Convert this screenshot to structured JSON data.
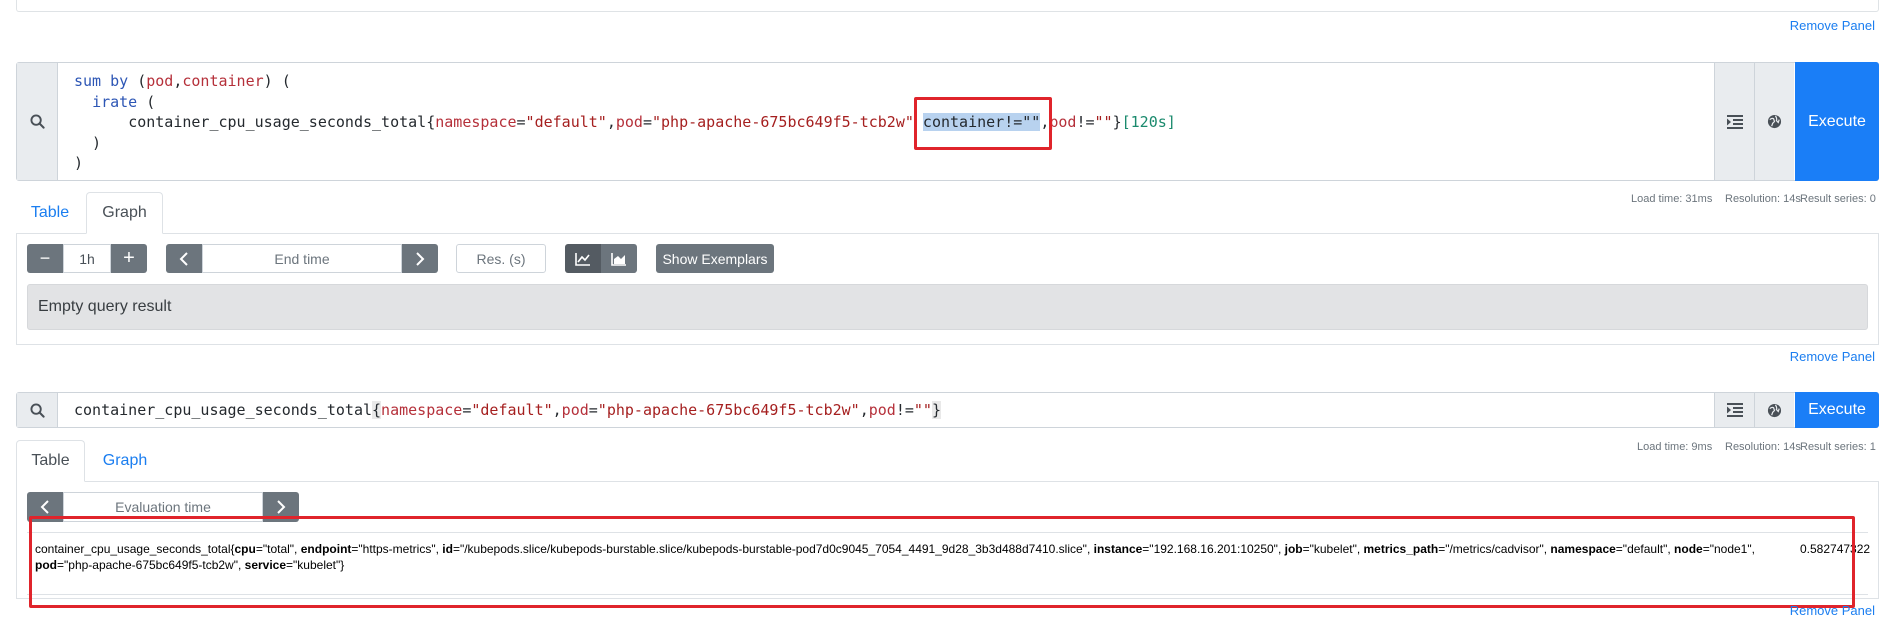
{
  "panel1": {
    "remove_label": "Remove Panel"
  },
  "panel2": {
    "query_lines": [
      [
        "sum by (pod,container) ("
      ],
      [
        "  irate ("
      ],
      [
        "      container_cpu_usage_seconds_total{namespace=\"default\",pod=\"php-apache-675bc649f5-tcb2w\" container!=\"\",pod!=\"\"}[120s]"
      ],
      [
        "  )"
      ],
      [
        ")"
      ]
    ],
    "q": {
      "l1_kw": "sum by",
      "l1_open": " (",
      "l1_pod": "pod",
      "l1_comma": ",",
      "l1_container": "container",
      "l1_close": ") (",
      "l2_kw": "irate",
      "l2_rest": " (",
      "l3_metric": "container_cpu_usage_seconds_total",
      "l3_brace_open": "{",
      "l3_ns_label": "namespace",
      "l3_eq1": "=",
      "l3_ns_val": "\"default\"",
      "l3_comma1": ",",
      "l3_pod_label": "pod",
      "l3_eq2": "=",
      "l3_pod_val": "\"php-apache-675bc649f5-tcb2w\"",
      "l3_space": " ",
      "l3_container_sel": "container!=\"\"",
      "l3_comma2": ",",
      "l3_pod2_label": "pod",
      "l3_neq": "!=",
      "l3_pod2_val": "\"\"",
      "l3_brace_close": "}",
      "l3_range": "[120s]",
      "l4": "  )",
      "l5": ")"
    },
    "execute_label": "Execute",
    "stats": {
      "load_time": "Load time: 31ms",
      "resolution": "Resolution: 14s",
      "result_series": "Result series: 0"
    },
    "tabs": {
      "table": "Table",
      "graph": "Graph"
    },
    "active_tab": "Graph",
    "graph_controls": {
      "minus": "−",
      "range": "1h",
      "plus": "+",
      "end_time_placeholder": "End time",
      "res_placeholder": "Res. (s)",
      "exemplars_label": "Show Exemplars"
    },
    "empty_result": "Empty query result",
    "remove_label": "Remove Panel"
  },
  "panel3": {
    "q": {
      "metric": "container_cpu_usage_seconds_total",
      "brace_open": "{",
      "ns_label": "namespace",
      "eq1": "=",
      "ns_val": "\"default\"",
      "comma1": ",",
      "pod_label": "pod",
      "eq2": "=",
      "pod_val": "\"php-apache-675bc649f5-tcb2w\"",
      "comma2": ",",
      "pod2_label": "pod",
      "neq": "!=",
      "pod2_val": "\"\"",
      "brace_close": "}"
    },
    "execute_label": "Execute",
    "stats": {
      "load_time": "Load time: 9ms",
      "resolution": "Resolution: 14s",
      "result_series": "Result series: 1"
    },
    "tabs": {
      "table": "Table",
      "graph": "Graph"
    },
    "active_tab": "Table",
    "eval_time_placeholder": "Evaluation time",
    "result": {
      "metric_name": "container_cpu_usage_seconds_total",
      "labels": [
        {
          "key": "cpu",
          "value": "\"total\""
        },
        {
          "key": "endpoint",
          "value": "\"https-metrics\""
        },
        {
          "key": "id",
          "value": "\"/kubepods.slice/kubepods-burstable.slice/kubepods-burstable-pod7d0c9045_7054_4491_9d28_3b3d488d7410.slice\""
        },
        {
          "key": "instance",
          "value": "\"192.168.16.201:10250\""
        },
        {
          "key": "job",
          "value": "\"kubelet\""
        },
        {
          "key": "metrics_path",
          "value": "\"/metrics/cadvisor\""
        },
        {
          "key": "namespace",
          "value": "\"default\""
        },
        {
          "key": "node",
          "value": "\"node1\""
        },
        {
          "key": "pod",
          "value": "\"php-apache-675bc649f5-tcb2w\""
        },
        {
          "key": "service",
          "value": "\"kubelet\""
        }
      ],
      "value": "0.582747322"
    },
    "remove_label": "Remove Panel"
  },
  "colors": {
    "execute_blue": "#1a7ef7",
    "link_blue": "#1b7ef0",
    "annotation_red": "#e0242b",
    "selection_blue": "#b8d2ef"
  }
}
